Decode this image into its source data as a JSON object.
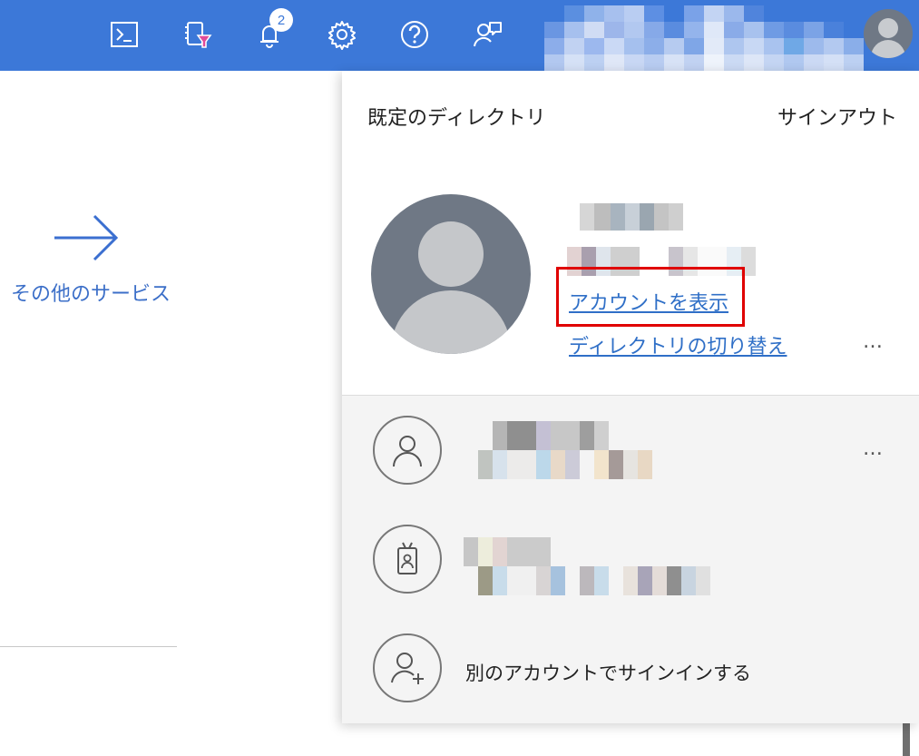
{
  "topbar": {
    "icons": [
      "cloud-shell-icon",
      "directory-filter-icon",
      "notifications-icon",
      "settings-icon",
      "help-icon",
      "feedback-icon"
    ],
    "notifications_count": "2",
    "accent_color": "#3c78d8"
  },
  "left": {
    "more_services_label": "その他のサービス"
  },
  "panel": {
    "directory_title": "既定のディレクトリ",
    "sign_out_label": "サインアウト",
    "view_account_link": "アカウントを表示",
    "switch_directory_link": "ディレクトリの切り替え",
    "more_options": "…",
    "sign_in_other_label": "別のアカウントでサインインする"
  }
}
